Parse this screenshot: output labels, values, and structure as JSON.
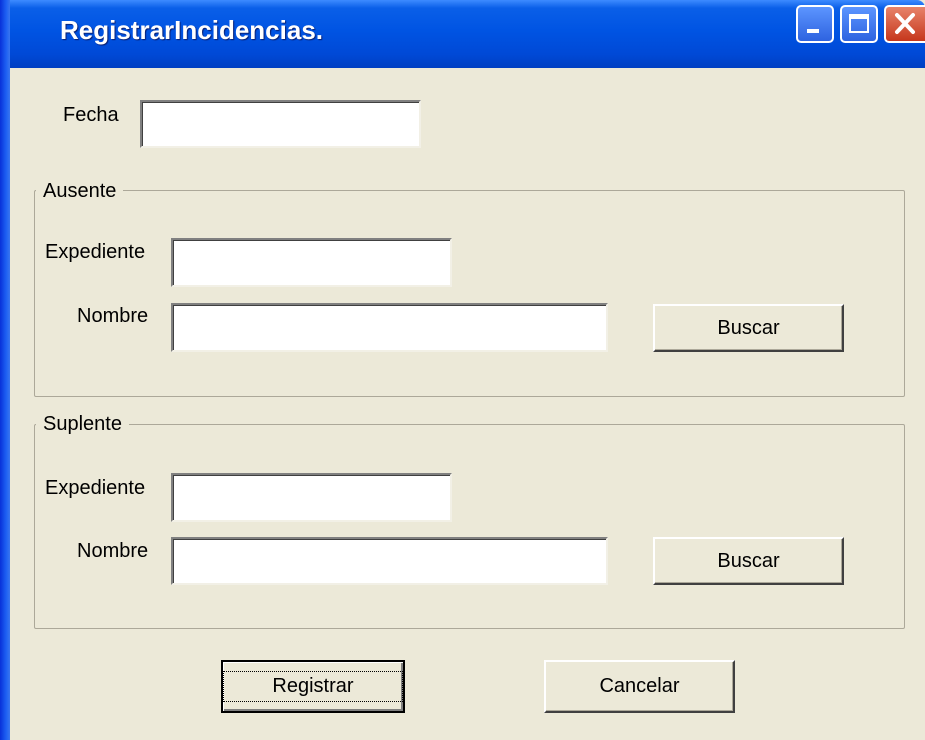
{
  "window": {
    "title": "RegistrarIncidencias.",
    "controls": [
      "minimize-icon",
      "maximize-icon",
      "close-icon"
    ]
  },
  "form": {
    "fecha": {
      "label": "Fecha",
      "value": ""
    },
    "ausente": {
      "legend": "Ausente",
      "expediente": {
        "label": "Expediente",
        "value": ""
      },
      "nombre": {
        "label": "Nombre",
        "value": ""
      },
      "buscar_label": "Buscar"
    },
    "suplente": {
      "legend": "Suplente",
      "expediente": {
        "label": "Expediente",
        "value": ""
      },
      "nombre": {
        "label": "Nombre",
        "value": ""
      },
      "buscar_label": "Buscar"
    },
    "registrar_label": "Registrar",
    "cancelar_label": "Cancelar"
  },
  "colors": {
    "titlebar": "#0054e3",
    "dialog_bg": "#ece9d8",
    "close_button": "#c6371c"
  }
}
